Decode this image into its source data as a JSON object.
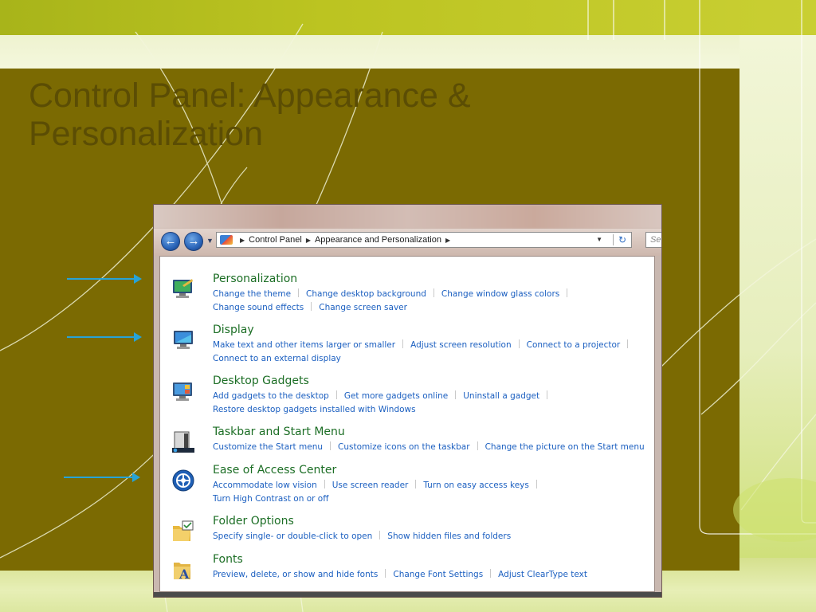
{
  "slide": {
    "title": "Control Panel: Appearance & Personalization"
  },
  "window": {
    "breadcrumb": [
      "Control Panel",
      "Appearance and Personalization"
    ],
    "search_placeholder": "Se"
  },
  "categories": [
    {
      "title": "Personalization",
      "icon": "personalization-icon",
      "lines": [
        [
          "Change the theme",
          "Change desktop background",
          "Change window glass colors"
        ],
        [
          "Change sound effects",
          "Change screen saver"
        ]
      ]
    },
    {
      "title": "Display",
      "icon": "display-icon",
      "lines": [
        [
          "Make text and other items larger or smaller",
          "Adjust screen resolution",
          "Connect to a projector"
        ],
        [
          "Connect to an external display"
        ]
      ]
    },
    {
      "title": "Desktop Gadgets",
      "icon": "desktop-gadgets-icon",
      "lines": [
        [
          "Add gadgets to the desktop",
          "Get more gadgets online",
          "Uninstall a gadget"
        ],
        [
          "Restore desktop gadgets installed with Windows"
        ]
      ]
    },
    {
      "title": "Taskbar and Start Menu",
      "icon": "taskbar-icon",
      "lines": [
        [
          "Customize the Start menu",
          "Customize icons on the taskbar",
          "Change the picture on the Start menu"
        ]
      ]
    },
    {
      "title": "Ease of Access Center",
      "icon": "ease-of-access-icon",
      "lines": [
        [
          "Accommodate low vision",
          "Use screen reader",
          "Turn on easy access keys"
        ],
        [
          "Turn High Contrast on or off"
        ]
      ]
    },
    {
      "title": "Folder Options",
      "icon": "folder-options-icon",
      "lines": [
        [
          "Specify single- or double-click to open",
          "Show hidden files and folders"
        ]
      ]
    },
    {
      "title": "Fonts",
      "icon": "fonts-icon",
      "lines": [
        [
          "Preview, delete, or show and hide fonts",
          "Change Font Settings",
          "Adjust ClearType text"
        ]
      ]
    }
  ],
  "colors": {
    "title_green": "#1c6e25",
    "link_blue": "#1b5fc0",
    "arrow_blue": "#27a3d6",
    "slide_brown": "#7b6a02"
  }
}
